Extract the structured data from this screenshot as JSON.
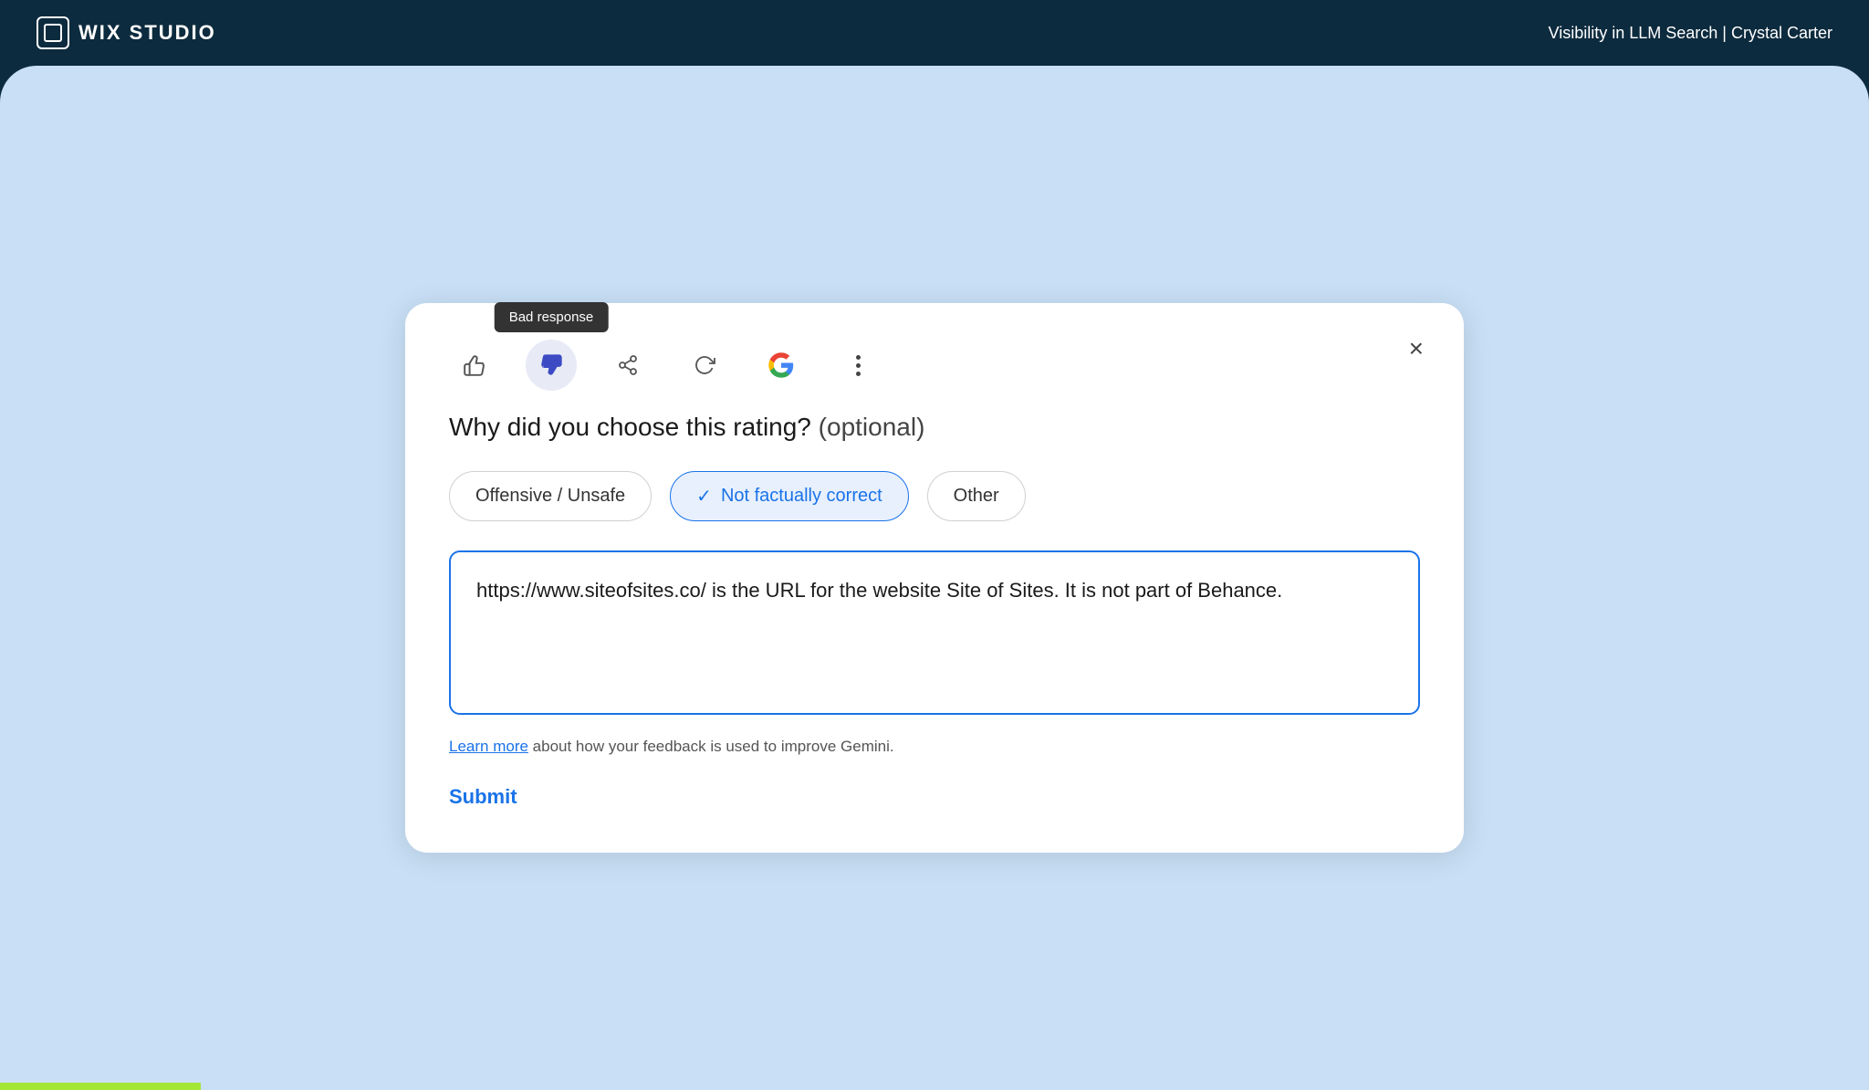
{
  "header": {
    "logo_text": "WIX STUDIO",
    "title": "Visibility in LLM Search | Crystal Carter"
  },
  "toolbar": {
    "thumbs_up_label": "thumbs-up",
    "thumbs_down_label": "thumbs-down",
    "share_label": "share",
    "refresh_label": "refresh",
    "google_label": "google",
    "more_label": "more options",
    "tooltip": "Bad response"
  },
  "dialog": {
    "question": "Why did you choose this rating?",
    "optional_label": "(optional)",
    "close_label": "×",
    "rating_options": [
      {
        "id": "offensive",
        "label": "Offensive / Unsafe",
        "selected": false
      },
      {
        "id": "not-factual",
        "label": "Not factually correct",
        "selected": true
      },
      {
        "id": "other",
        "label": "Other",
        "selected": false
      }
    ],
    "textarea_value": "https://www.siteofsites.co/ is the URL for the website Site of Sites. It is not part of Behance.",
    "textarea_placeholder": "",
    "learn_more_link": "Learn more",
    "learn_more_text": " about how your feedback is used to improve Gemini.",
    "submit_label": "Submit"
  }
}
